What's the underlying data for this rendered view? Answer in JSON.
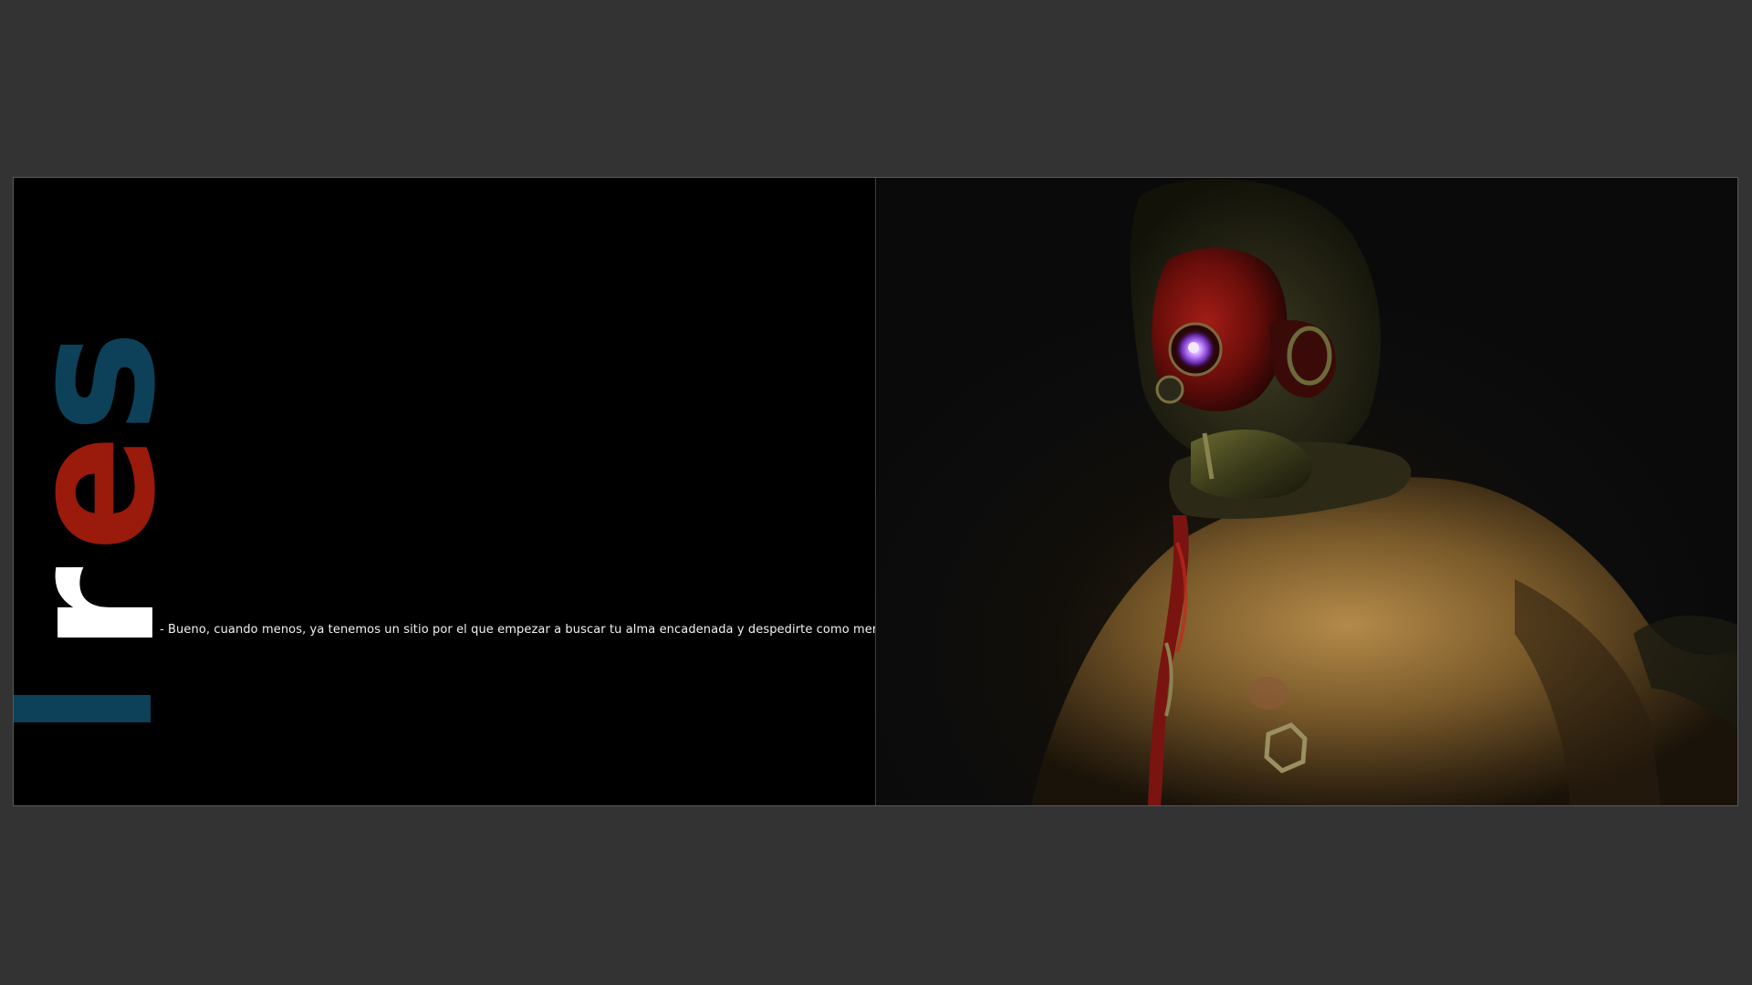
{
  "logo": {
    "letters": [
      "r",
      "e",
      "s"
    ],
    "colors": {
      "r": "#ffffff",
      "e": "#9a1a0c",
      "s": "#0c4159",
      "bar": "#0c4159"
    }
  },
  "caption": "- Bueno, cuando menos, ya tenemos un sitio por el que empezar a buscar tu alma encadenada y despedirte como mereces.",
  "colors": {
    "viewer_background": "#333333",
    "page_background": "#000000",
    "mask_red": "#8e1410",
    "eye_glow": "#a060ff",
    "skin_tone": "#b08040"
  }
}
